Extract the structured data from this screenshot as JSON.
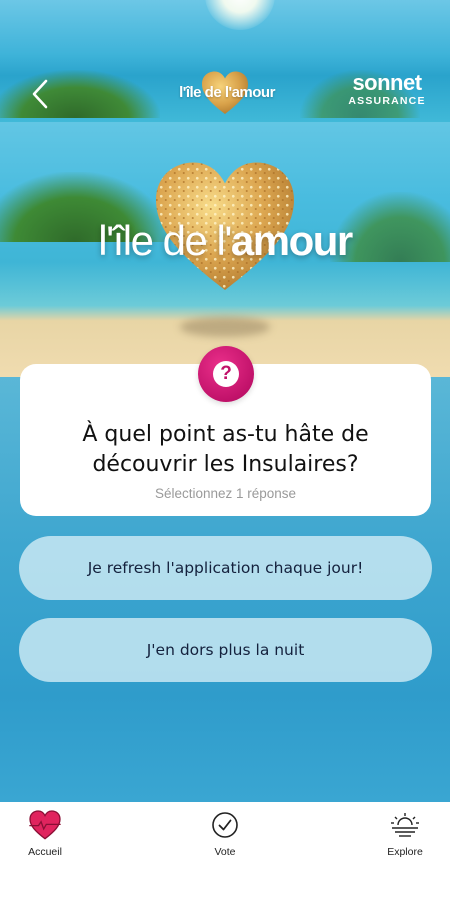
{
  "header": {
    "logo_text": "l'île de l'amour",
    "sponsor_name": "sonnet",
    "sponsor_sub": "ASSURANCE"
  },
  "hero": {
    "title_prefix": "l'île de l'",
    "title_bold": "amour"
  },
  "question": {
    "text": "À quel point as-tu hâte de découvrir les Insulaires?",
    "hint": "Sélectionnez 1 réponse",
    "icon_glyph": "?"
  },
  "answers": [
    {
      "label": "Je refresh l'application chaque jour!"
    },
    {
      "label": "J'en dors plus la nuit"
    }
  ],
  "nav": {
    "items": [
      {
        "label": "Accueil",
        "icon": "heart-icon"
      },
      {
        "label": "Vote",
        "icon": "check-circle-icon"
      },
      {
        "label": "Explore",
        "icon": "sunset-icon"
      }
    ]
  },
  "colors": {
    "accent": "#c1126a",
    "heart_nav": "#e0245e"
  }
}
